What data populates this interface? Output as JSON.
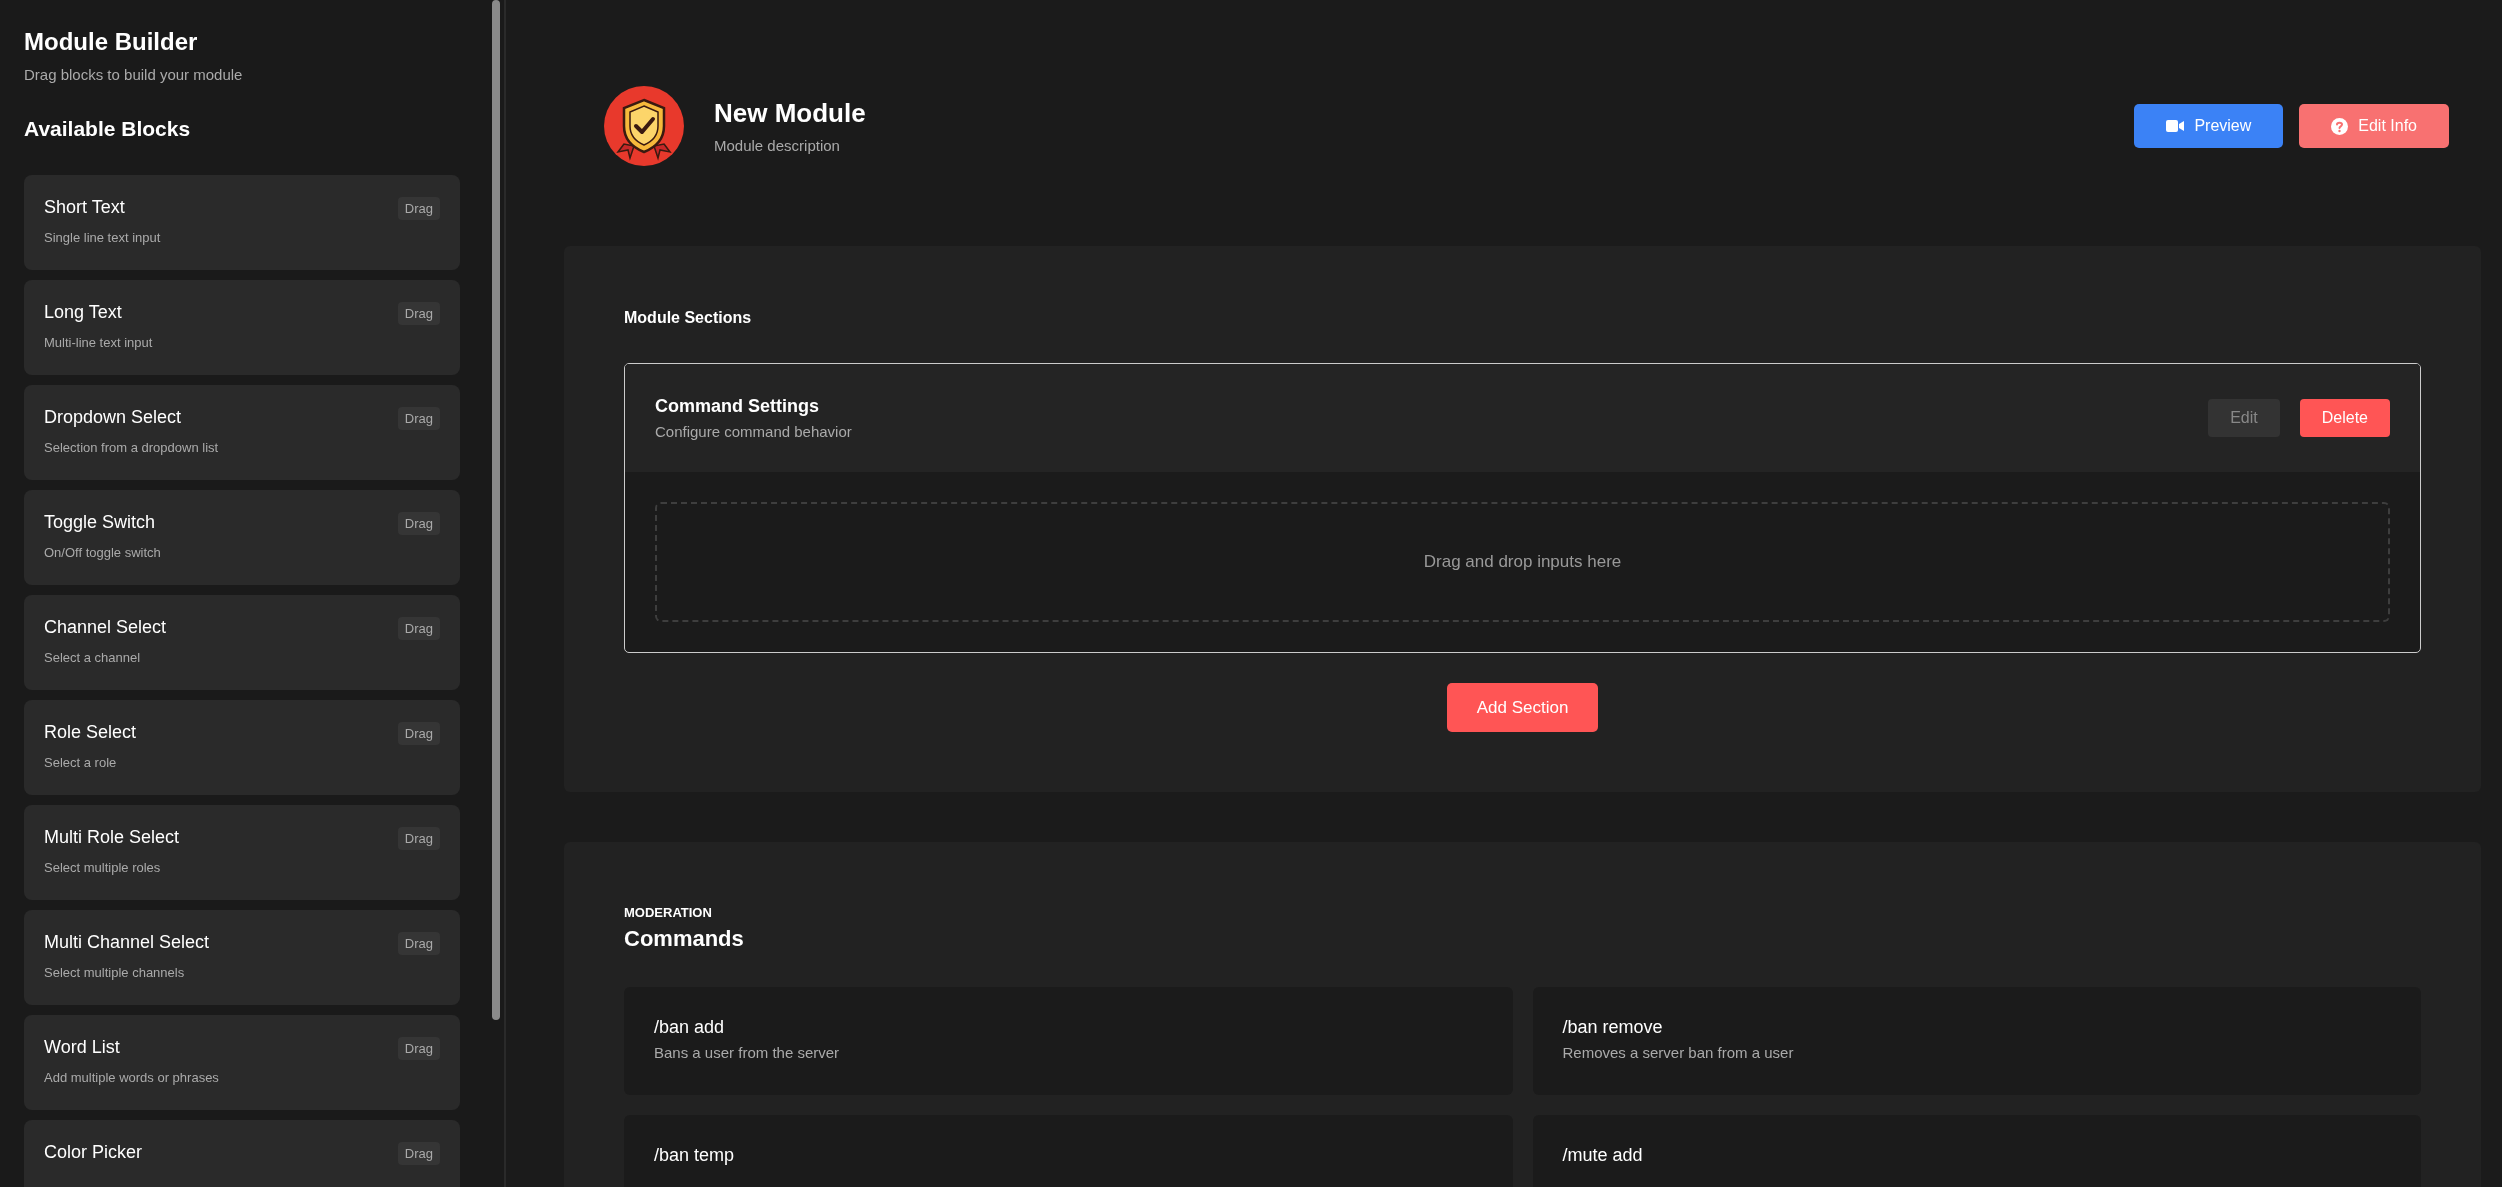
{
  "sidebar": {
    "title": "Module Builder",
    "subtitle": "Drag blocks to build your module",
    "section_title": "Available Blocks",
    "blocks": [
      {
        "title": "Short Text",
        "description": "Single line text input",
        "badge": "Drag"
      },
      {
        "title": "Long Text",
        "description": "Multi-line text input",
        "badge": "Drag"
      },
      {
        "title": "Dropdown Select",
        "description": "Selection from a dropdown list",
        "badge": "Drag"
      },
      {
        "title": "Toggle Switch",
        "description": "On/Off toggle switch",
        "badge": "Drag"
      },
      {
        "title": "Channel Select",
        "description": "Select a channel",
        "badge": "Drag"
      },
      {
        "title": "Role Select",
        "description": "Select a role",
        "badge": "Drag"
      },
      {
        "title": "Multi Role Select",
        "description": "Select multiple roles",
        "badge": "Drag"
      },
      {
        "title": "Multi Channel Select",
        "description": "Select multiple channels",
        "badge": "Drag"
      },
      {
        "title": "Word List",
        "description": "Add multiple words or phrases",
        "badge": "Drag"
      },
      {
        "title": "Color Picker",
        "badge": "Drag"
      }
    ]
  },
  "header": {
    "title": "New Module",
    "description": "Module description",
    "buttons": [
      {
        "label": "Preview",
        "kind": "preview"
      },
      {
        "label": "Edit Info",
        "kind": "edit_info"
      }
    ]
  },
  "sections_panel": {
    "title": "Module Sections",
    "sections": [
      {
        "title": "Command Settings",
        "description": "Configure command behavior",
        "buttons": [
          {
            "label": "Edit",
            "kind": "edit"
          },
          {
            "label": "Delete",
            "kind": "delete"
          }
        ],
        "dropzone_text": "Drag and drop inputs here"
      }
    ],
    "add_button": "Add Section"
  },
  "commands_panel": {
    "category": "MODERATION",
    "title": "Commands",
    "commands": [
      {
        "name": "/ban add",
        "description": "Bans a user from the server"
      },
      {
        "name": "/ban remove",
        "description": "Removes a server ban from a user"
      },
      {
        "name": "/ban temp"
      },
      {
        "name": "/mute add"
      }
    ]
  }
}
